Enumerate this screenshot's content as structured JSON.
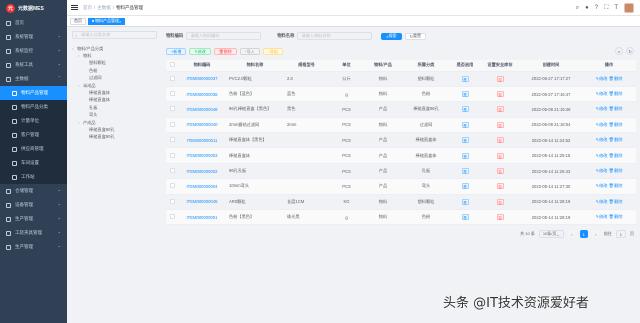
{
  "app": {
    "title": "元数据MES",
    "logo_char": "元"
  },
  "menu": [
    {
      "label": "首页"
    },
    {
      "label": "系统管理"
    },
    {
      "label": "系统监控"
    },
    {
      "label": "系统工具"
    },
    {
      "label": "主数据"
    }
  ],
  "submenu": [
    {
      "label": "物料产品管理"
    },
    {
      "label": "物料产品分类"
    },
    {
      "label": "计量单位"
    },
    {
      "label": "客户管理"
    },
    {
      "label": "供应商管理"
    },
    {
      "label": "车间设置"
    },
    {
      "label": "工作站"
    }
  ],
  "menu_bottom": [
    {
      "label": "仓储管理"
    },
    {
      "label": "设备管理"
    },
    {
      "label": "生产管理"
    },
    {
      "label": "工装夹具管理"
    },
    {
      "label": "生产管理"
    }
  ],
  "breadcrumb": [
    "首页",
    "主数据",
    "物料产品管理"
  ],
  "tags": [
    "首页",
    "物料产品管理"
  ],
  "tree": {
    "search_placeholder": "请输入分类名称",
    "nodes": [
      {
        "label": "物料/产品分类",
        "level": 0
      },
      {
        "label": "物料",
        "level": 1
      },
      {
        "label": "塑料颗粒",
        "level": 2
      },
      {
        "label": "色粉",
        "level": 2
      },
      {
        "label": "过滤网",
        "level": 2
      },
      {
        "label": "半成品",
        "level": 1
      },
      {
        "label": "棒槌直盒体",
        "level": 2
      },
      {
        "label": "棒槌直盒体",
        "level": 2
      },
      {
        "label": "孔板",
        "level": 2
      },
      {
        "label": "弯头",
        "level": 2
      },
      {
        "label": "产成品",
        "level": 1
      },
      {
        "label": "棒槌直盒90孔",
        "level": 2
      },
      {
        "label": "棒槌直盒90孔",
        "level": 2
      }
    ]
  },
  "filters": {
    "code_label": "物料编码",
    "code_placeholder": "请输入物料编码",
    "name_label": "物料名称",
    "name_placeholder": "请输入物料名称",
    "search": "搜索",
    "reset": "重置"
  },
  "toolbar": {
    "add": "新增",
    "edit": "修改",
    "delete": "删除",
    "import": "导入",
    "export": "导出"
  },
  "table": {
    "headers": [
      "物料编码",
      "物料名称",
      "规格型号",
      "单位",
      "物料/产品",
      "所属分类",
      "是否启用",
      "设置安全库存",
      "创建时间",
      "操作"
    ],
    "op_edit": "修改",
    "op_delete": "删除",
    "rows": [
      {
        "code": "ITEM000000037",
        "name": "PVC2.0颗粒",
        "spec": "2.0",
        "unit": "公斤",
        "type": "物料",
        "cat": "塑料颗粒",
        "enable": "是",
        "safe": "否",
        "time": "2022-05-27 17:17:27"
      },
      {
        "code": "ITEM000000036",
        "name": "色粉【蓝色】",
        "spec": "蓝色",
        "unit": "g",
        "type": "物料",
        "cat": "色粉",
        "enable": "是",
        "safe": "否",
        "time": "2022-05-27 17:16:47"
      },
      {
        "code": "ITEM000000048",
        "name": "96孔棒槌直盒【黑色】",
        "spec": "黑色",
        "unit": "PCS",
        "type": "产品",
        "cat": "棒槌直盒96孔",
        "enable": "是",
        "safe": "否",
        "time": "2022-05-09 21:19:48"
      },
      {
        "code": "ITEM000000040",
        "name": "2mm霸结过滤网",
        "spec": "2mm",
        "unit": "PCS",
        "type": "物料",
        "cat": "过滤网",
        "enable": "是",
        "safe": "否",
        "time": "2022-05-09 21:18:54"
      },
      {
        "code": "ITEM000000011",
        "name": "棒槌直盒体【黑色】",
        "spec": "",
        "unit": "PCS",
        "type": "产品",
        "cat": "棒槌直盒体",
        "enable": "是",
        "safe": "否",
        "time": "2022-05-14 11:24:52"
      },
      {
        "code": "ITEM000000003",
        "name": "棒槌直盒体",
        "spec": "",
        "unit": "PCS",
        "type": "产品",
        "cat": "棒槌直盒体",
        "enable": "是",
        "safe": "否",
        "time": "2022-05-14 11:25:18"
      },
      {
        "code": "ITEM000000002",
        "name": "96孔孔板",
        "spec": "",
        "unit": "PCS",
        "type": "产品",
        "cat": "孔板",
        "enable": "是",
        "safe": "否",
        "time": "2022-05-14 11:26:43"
      },
      {
        "code": "ITEM000000004",
        "name": "10mm弯头",
        "spec": "",
        "unit": "PCS",
        "type": "产品",
        "cat": "弯头",
        "enable": "是",
        "safe": "否",
        "time": "2022-05-14 11:27:30"
      },
      {
        "code": "ITEM000000045",
        "name": "AR0颗粒",
        "spec": "长度1CM",
        "unit": "KG",
        "type": "物料",
        "cat": "塑料颗粒",
        "enable": "是",
        "safe": "否",
        "time": "2022-05-14 11:28:19"
      },
      {
        "code": "ITEM000000001",
        "name": "色粉【黑色】",
        "spec": "珠光黑",
        "unit": "g",
        "type": "物料",
        "cat": "色粉",
        "enable": "是",
        "safe": "否",
        "time": "2022-05-14 11:28:19"
      }
    ]
  },
  "pagination": {
    "total": "共 10 条",
    "size": "10条/页",
    "page": "1",
    "goto": "前往",
    "page_unit": "页"
  },
  "watermark": "头条 @IT技术资源爱好者"
}
